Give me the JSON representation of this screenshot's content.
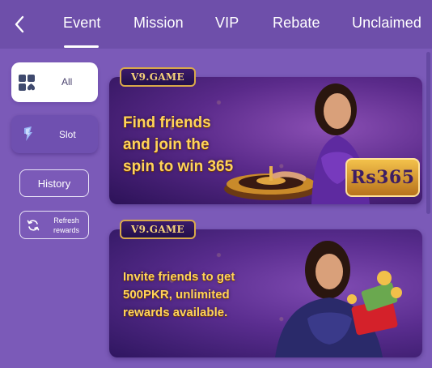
{
  "header": {
    "back_icon": "chevron-left-icon",
    "tabs": [
      {
        "label": "Event",
        "active": true
      },
      {
        "label": "Mission",
        "active": false
      },
      {
        "label": "VIP",
        "active": false
      },
      {
        "label": "Rebate",
        "active": false
      },
      {
        "label": "Unclaimed",
        "active": false
      }
    ]
  },
  "sidebar": {
    "categories": [
      {
        "label": "All",
        "icon": "grid-icon",
        "selected": true
      },
      {
        "label": "Slot",
        "icon": "slot-icon",
        "selected": false
      }
    ],
    "history_label": "History",
    "refresh_label_line1": "Refresh",
    "refresh_label_line2": "rewards"
  },
  "banners": [
    {
      "logo": "V9.GAME",
      "lines": [
        "Find friends",
        "and join the",
        "spin to win 365"
      ],
      "badge": "Rs365"
    },
    {
      "logo": "V9.GAME",
      "lines": [
        "Invite friends to get",
        "500PKR, unlimited",
        "rewards available."
      ]
    }
  ],
  "colors": {
    "background": "#7b5ab8",
    "header": "#6e4faa",
    "promo_text": "#ffd35a",
    "badge_gold": "#f3c14b"
  }
}
